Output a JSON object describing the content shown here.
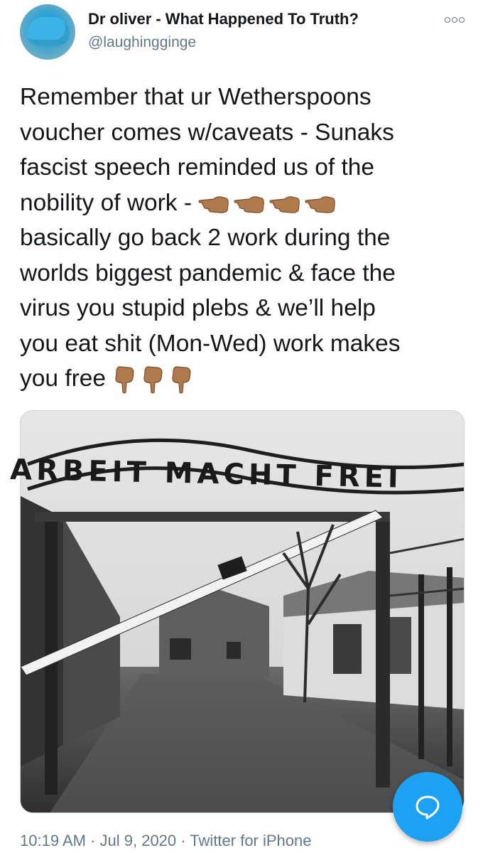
{
  "author": {
    "display_name": "Dr oliver - What Happened To Truth?",
    "handle": "@laughingginge"
  },
  "tweet": {
    "line_1": "Remember that ur Wetherspoons",
    "line_2": "voucher comes w/caveats - Sunaks",
    "line_3": "fascist speech reminded us of the",
    "line_4": "nobility of work - ",
    "line_5": "basically go back 2 work during the",
    "line_6": "worlds biggest pandemic & face the",
    "line_7": "virus you stupid plebs & we’ll help",
    "line_8": "you eat shit (Mon-Wed) work makes",
    "line_9": "you free ",
    "pointing_left_emoji": "backhand-index-pointing-left",
    "pointing_down_emoji": "backhand-index-pointing-down"
  },
  "media": {
    "sign_text": "ARBEIT MACHT FREI"
  },
  "meta": {
    "time": "10:19 AM",
    "separator_1": " · ",
    "date": "Jul 9, 2020",
    "separator_2": " · ",
    "source": "Twitter for iPhone"
  },
  "colors": {
    "accent": "#1da1f2",
    "secondary_text": "#657786",
    "primary_text": "#14171a",
    "skin_tone": "#b07a4f"
  },
  "icons": {
    "more": "more-options-icon",
    "compose": "reply-bubble-icon"
  }
}
